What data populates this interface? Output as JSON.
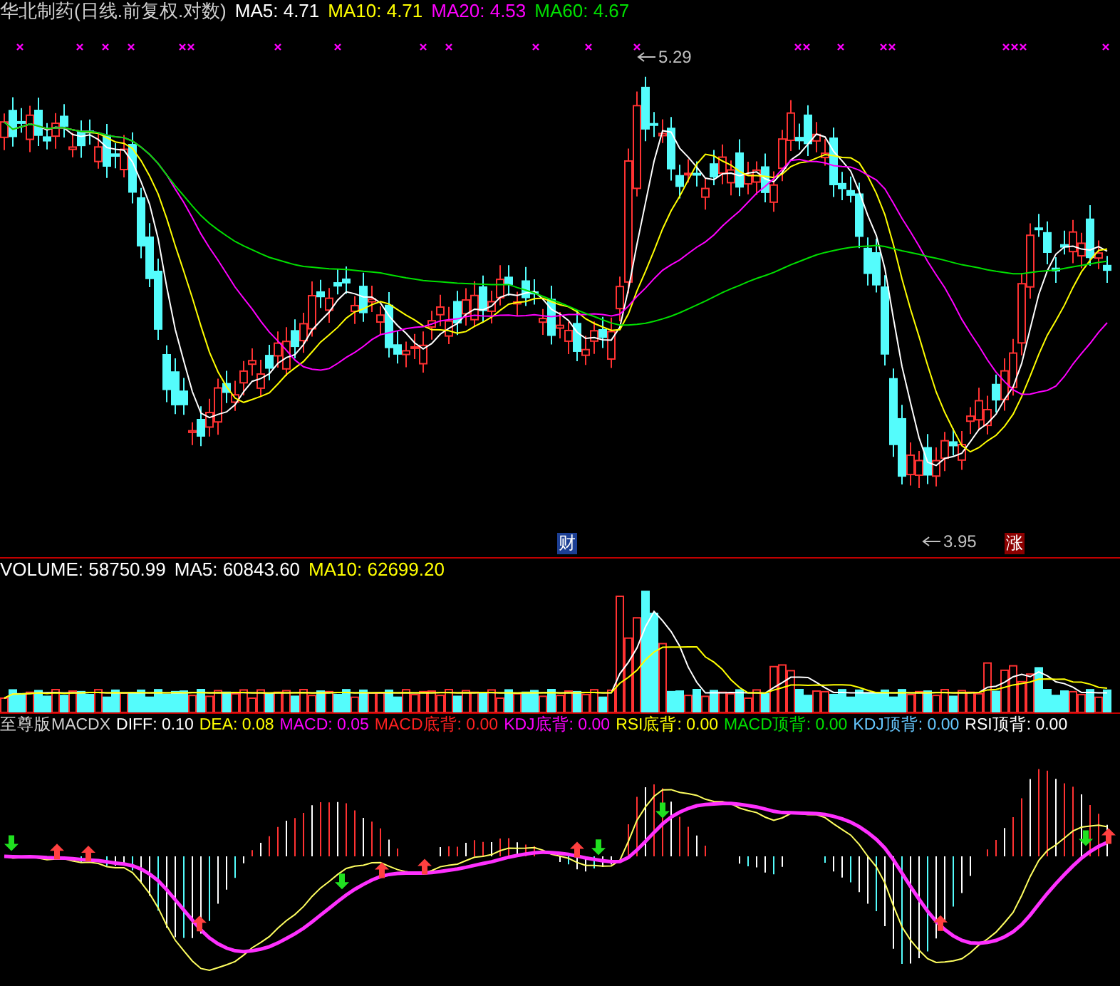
{
  "price_panel": {
    "title": "华北制药(日线.前复权.对数)",
    "indicators": [
      {
        "label": "MA5: 4.71",
        "color": "#ffffff"
      },
      {
        "label": "MA10: 4.71",
        "color": "#ffff00"
      },
      {
        "label": "MA20: 4.53",
        "color": "#ff00ff"
      },
      {
        "label": "MA60: 4.67",
        "color": "#00e000"
      }
    ],
    "high_label": "5.29",
    "low_label": "3.95",
    "markers": [
      {
        "text": "财",
        "color": "#1c3f94"
      },
      {
        "text": "涨",
        "color": "#8c0000"
      }
    ]
  },
  "volume_panel": {
    "indicators": [
      {
        "label": "VOLUME: 58750.99",
        "color": "#ffffff"
      },
      {
        "label": "MA5: 60843.60",
        "color": "#ffffff"
      },
      {
        "label": "MA10: 62699.20",
        "color": "#ffff00"
      }
    ]
  },
  "macd_panel": {
    "title": "至尊版MACDX",
    "indicators": [
      {
        "label": "DIFF: 0.10",
        "color": "#ffffff"
      },
      {
        "label": "DEA: 0.08",
        "color": "#ffff00"
      },
      {
        "label": "MACD: 0.05",
        "color": "#ff00ff"
      },
      {
        "label": "MACD底背: 0.00",
        "color": "#ff2020"
      },
      {
        "label": "KDJ底背: 0.00",
        "color": "#ff00ff"
      },
      {
        "label": "RSI底背: 0.00",
        "color": "#ffff00"
      },
      {
        "label": "MACD顶背: 0.00",
        "color": "#00e000"
      },
      {
        "label": "KDJ顶背: 0.00",
        "color": "#66c8ff"
      },
      {
        "label": "RSI顶背: 0.00",
        "color": "#ffffff"
      }
    ]
  }
}
